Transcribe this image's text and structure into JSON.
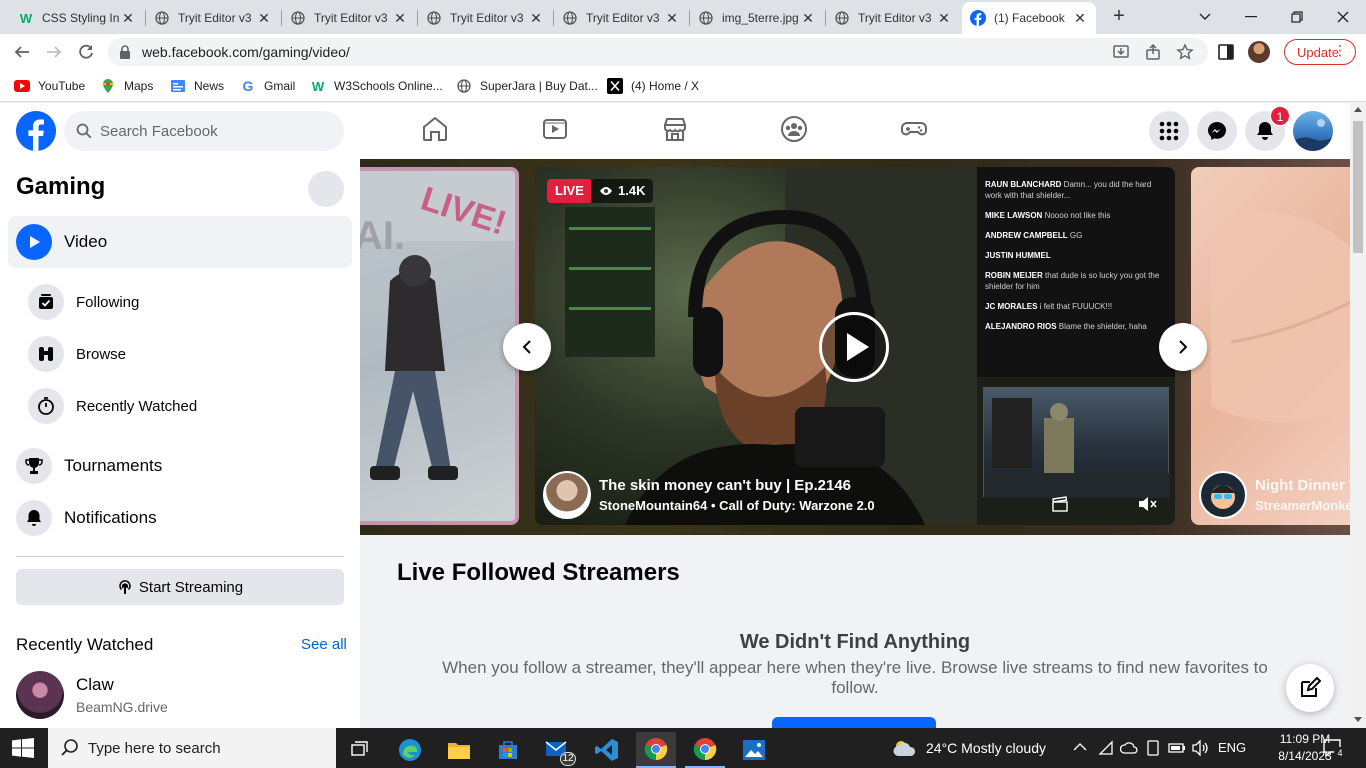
{
  "browser": {
    "tabs": [
      {
        "title": "CSS Styling In",
        "icon": "w3schools-icon"
      },
      {
        "title": "Tryit Editor v3",
        "icon": "globe-icon"
      },
      {
        "title": "Tryit Editor v3",
        "icon": "globe-icon"
      },
      {
        "title": "Tryit Editor v3",
        "icon": "globe-icon"
      },
      {
        "title": "Tryit Editor v3",
        "icon": "globe-icon"
      },
      {
        "title": "img_5terre.jpg",
        "icon": "globe-icon"
      },
      {
        "title": "Tryit Editor v3",
        "icon": "globe-icon"
      },
      {
        "title": "(1) Facebook",
        "icon": "facebook-icon",
        "active": true
      }
    ],
    "url": "web.facebook.com/gaming/video/",
    "update_label": "Update",
    "bookmarks": [
      {
        "label": "YouTube",
        "icon": "youtube-icon"
      },
      {
        "label": "Maps",
        "icon": "maps-icon"
      },
      {
        "label": "News",
        "icon": "news-icon"
      },
      {
        "label": "Gmail",
        "icon": "google-icon"
      },
      {
        "label": "W3Schools Online...",
        "icon": "w3schools-icon"
      },
      {
        "label": "SuperJara | Buy Dat...",
        "icon": "globe-icon"
      },
      {
        "label": "(4) Home / X",
        "icon": "x-icon"
      }
    ]
  },
  "fb": {
    "search_placeholder": "Search Facebook",
    "notifications_count": "1",
    "accent": "#0866ff"
  },
  "sidebar": {
    "title": "Gaming",
    "video_label": "Video",
    "sub_items": [
      {
        "label": "Following",
        "icon": "following-icon"
      },
      {
        "label": "Browse",
        "icon": "binoculars-icon"
      },
      {
        "label": "Recently Watched",
        "icon": "stopwatch-icon"
      }
    ],
    "tournaments_label": "Tournaments",
    "notifications_label": "Notifications",
    "start_streaming_label": "Start Streaming",
    "recently_watched_title": "Recently Watched",
    "see_all_label": "See all",
    "recent": {
      "name": "Claw",
      "game": "BeamNG.drive"
    }
  },
  "carousel": {
    "live_label": "LIVE",
    "viewers": "1.4K",
    "main_title": "The skin money can't buy | Ep.2146",
    "main_sub": "StoneMountain64 • Call of Duty: Warzone 2.0",
    "right_title": "Night Dinner T",
    "right_sub": "StreamerMonke",
    "chat": [
      {
        "user": "RAUN BLANCHARD",
        "msg": "Damn... you did the hard work with that shielder..."
      },
      {
        "user": "MIKE LAWSON",
        "msg": "Noooo not like this"
      },
      {
        "user": "ANDREW CAMPBELL",
        "msg": "GG"
      },
      {
        "user": "JUSTIN HUMMEL",
        "msg": ""
      },
      {
        "user": "ROBIN MEIJER",
        "msg": "that dude is so lucky you got the shielder for him"
      },
      {
        "user": "JC MORALES",
        "msg": "i felt that FUUUCK!!!"
      },
      {
        "user": "ALEJANDRO RIOS",
        "msg": "Blame the shielder, haha"
      }
    ]
  },
  "main": {
    "section_title": "Live Followed Streamers",
    "empty_title": "We Didn't Find Anything",
    "empty_desc": "When you follow a streamer, they'll appear here when they're live. Browse live streams to find new favorites to follow."
  },
  "taskbar": {
    "search_placeholder": "Type here to search",
    "mail_badge": "12",
    "weather": "24°C  Mostly cloudy",
    "lang": "ENG",
    "time": "11:09 PM",
    "date": "8/14/2023",
    "notif_count": "4"
  }
}
